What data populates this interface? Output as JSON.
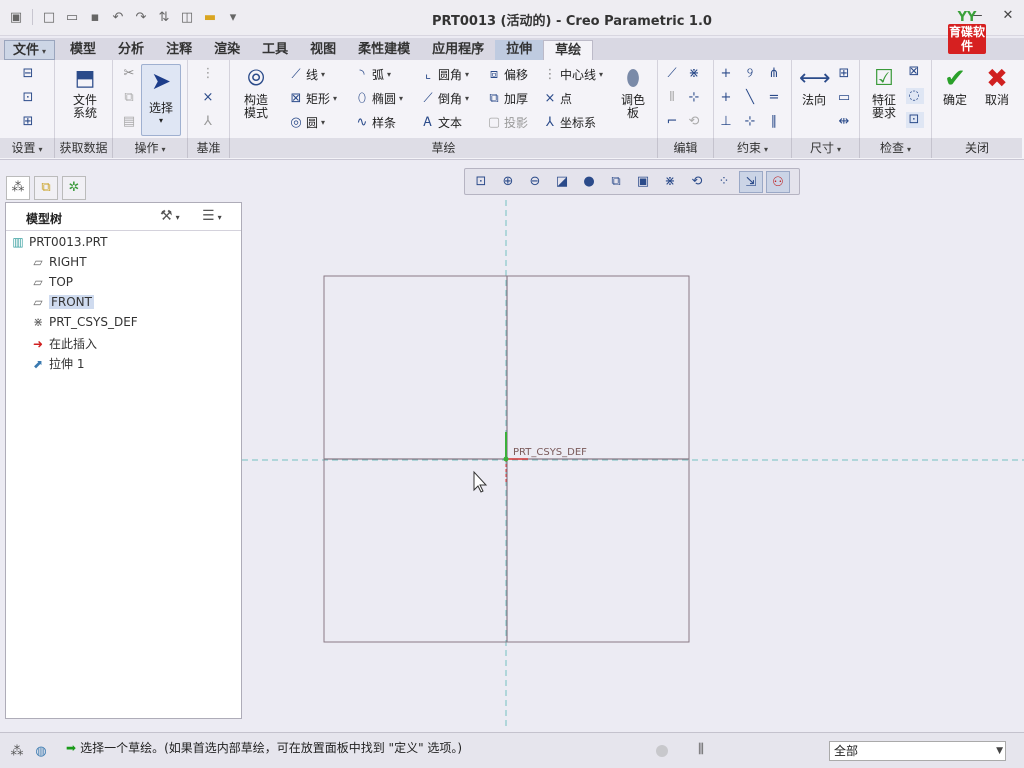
{
  "window": {
    "title": "PRT0013 (活动的) - Creo Parametric 1.0",
    "logo_top": "YY",
    "logo_text": "育碟软件"
  },
  "ribbon_tabs": [
    {
      "label": "文件",
      "id": "file"
    },
    {
      "label": "模型",
      "id": "model"
    },
    {
      "label": "分析",
      "id": "analysis"
    },
    {
      "label": "注释",
      "id": "annotate"
    },
    {
      "label": "渲染",
      "id": "render"
    },
    {
      "label": "工具",
      "id": "tools"
    },
    {
      "label": "视图",
      "id": "view"
    },
    {
      "label": "柔性建模",
      "id": "flexible"
    },
    {
      "label": "应用程序",
      "id": "apps"
    },
    {
      "label": "拉伸",
      "id": "extrude"
    },
    {
      "label": "草绘",
      "id": "sketch"
    }
  ],
  "ribbon": {
    "file_system": "文件\n系统",
    "select": "选择",
    "construct_mode": "构造\n模式",
    "line": "线",
    "arc": "弧",
    "fillet": "圆角",
    "offset": "偏移",
    "centerline": "中心线",
    "rectangle": "矩形",
    "ellipse": "椭圆",
    "chamfer": "倒角",
    "thicken": "加厚",
    "point": "点",
    "circle": "圆",
    "spline": "样条",
    "text": "文本",
    "project": "投影",
    "coord_sys": "坐标系",
    "palette": "调色\n板",
    "normal": "法向",
    "feature_req": "特征\n要求",
    "ok": "确定",
    "cancel": "取消"
  },
  "group_footers": {
    "setup": "设置",
    "get_data": "获取数据",
    "operations": "操作",
    "datum": "基准",
    "sketching": "草绘",
    "editing": "编辑",
    "constrain": "约束",
    "dimension": "尺寸",
    "inspect": "检查",
    "close": "关闭"
  },
  "model_tree": {
    "title": "模型树",
    "items": [
      {
        "label": "PRT0013.PRT",
        "icon": "part-icon"
      },
      {
        "label": "RIGHT",
        "icon": "datum-plane-icon"
      },
      {
        "label": "TOP",
        "icon": "datum-plane-icon"
      },
      {
        "label": "FRONT",
        "icon": "datum-plane-icon"
      },
      {
        "label": "PRT_CSYS_DEF",
        "icon": "csys-icon"
      },
      {
        "label": "在此插入",
        "icon": "insert-here-arrow-icon"
      },
      {
        "label": "拉伸 1",
        "icon": "extrude-icon"
      }
    ]
  },
  "graphics": {
    "csys_label": "PRT_CSYS_DEF"
  },
  "status": {
    "message": "选择一个草绘。(如果首选内部草绘，可在放置面板中找到 \"定义\" 选项。)",
    "filter_value": "全部"
  },
  "colors": {
    "sketch_bg": "#ecebf3",
    "datum_line": "#74c2c2",
    "csys_red": "#d83a3a",
    "csys_green": "#3ab03a",
    "accent_blue": "#2b4b8a"
  }
}
